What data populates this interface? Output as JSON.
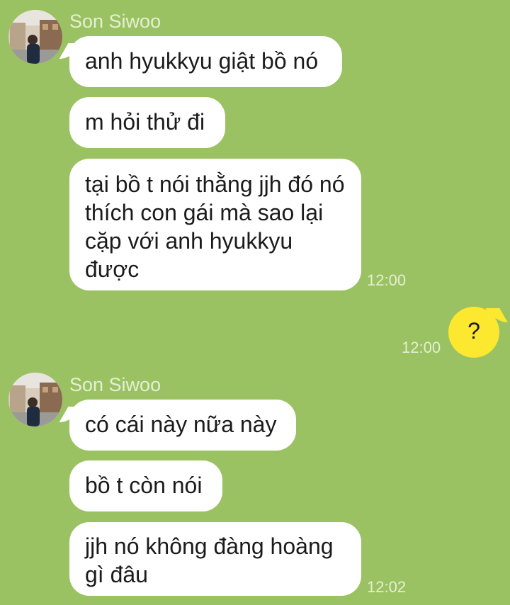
{
  "groups": [
    {
      "sender": "Son Siwoo",
      "messages": [
        "anh hyukkyu giật bồ nó",
        "m hỏi thử đi",
        "tại bồ t nói thằng jjh đó nó thích con gái mà sao lại cặp với anh hyukkyu được"
      ],
      "time": "12:00"
    },
    {
      "sender": "Son Siwoo",
      "messages": [
        "có cái này nữa này",
        "bồ t còn nói",
        "jjh nó không đàng hoàng gì đâu"
      ],
      "time": "12:02"
    }
  ],
  "my_message": {
    "text": "?",
    "time": "12:00"
  },
  "colors": {
    "background": "#9bc262",
    "incoming_bubble": "#ffffff",
    "outgoing_bubble": "#fbe82f",
    "meta_text": "#e4efd3"
  }
}
